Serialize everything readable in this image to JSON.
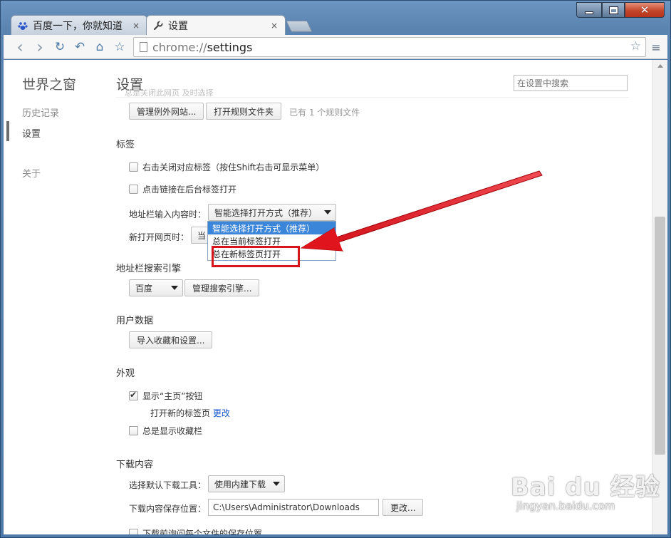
{
  "window": {
    "minimize_icon": "minimize-icon",
    "maximize_icon": "maximize-icon",
    "close_icon": "close-icon",
    "close_color": "#c2462a"
  },
  "tabs": [
    {
      "title": "百度一下，你就知道",
      "icon": "baidu-paw-icon",
      "close": "×"
    },
    {
      "title": "设置",
      "icon": "wrench-icon",
      "close": "×"
    }
  ],
  "toolbar": {
    "back": "‹",
    "forward": "›",
    "reload": "↻",
    "undo": "↶",
    "home": "⌂",
    "star": "☆",
    "url_scheme": "chrome://",
    "url_path": "settings",
    "bookmark_star": "☆",
    "menu": "≡"
  },
  "sidebar": {
    "brand": "世界之窗",
    "items": [
      {
        "label": "历史记录"
      },
      {
        "label": "设置"
      },
      {
        "label": "关于"
      }
    ]
  },
  "header": {
    "title": "设置",
    "search_placeholder": "在设置中搜索",
    "faded_line": "总是关闭此网页 及时选择"
  },
  "rules": {
    "manage_exceptions": "管理例外网站...",
    "open_rules_folder": "打开规则文件夹",
    "rules_count": "已有 1 个规则文件"
  },
  "tabs_section": {
    "heading": "标签",
    "close_on_right_click": "右击关闭对应标签（按住Shift右击可显示菜单）",
    "open_links_background": "点击链接在后台标签打开",
    "address_input_label": "地址栏输入内容时：",
    "address_input_value": "智能选择打开方式（推荐）",
    "new_page_label": "新打开网页时：",
    "new_page_value": "当",
    "dropdown_options": [
      "智能选择打开方式（推荐）",
      "总在当前标签打开",
      "总在新标签页打开"
    ]
  },
  "search_engine": {
    "heading": "地址栏搜索引擎",
    "value": "百度",
    "manage": "管理搜索引擎..."
  },
  "user_data": {
    "heading": "用户数据",
    "import": "导入收藏和设置..."
  },
  "appearance": {
    "heading": "外观",
    "show_home": "显示“主页”按钮",
    "show_home_checked": true,
    "new_tab_text": "打开新的标签页",
    "change_link": "更改",
    "always_bookmarks": "总是显示收藏栏"
  },
  "downloads": {
    "heading": "下载内容",
    "tool_label": "选择默认下载工具：",
    "tool_value": "使用内建下载",
    "path_label": "下载内容保存位置：",
    "path_value": "C:\\Users\\Administrator\\Downloads",
    "change": "更改...",
    "ask_each": "下载前询问每个文件的保存位置"
  },
  "annotation": {
    "highlight_color": "#d8141c",
    "arrow_color": "#e0141c"
  },
  "watermark": {
    "logo": "Bai du 经验",
    "url": "jingyan.baidu.com"
  }
}
